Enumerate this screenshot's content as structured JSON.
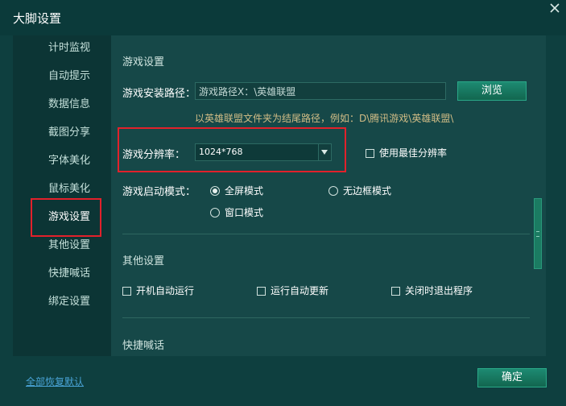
{
  "window": {
    "title": "大脚设置"
  },
  "sidebar": {
    "items": [
      {
        "label": "计时监视"
      },
      {
        "label": "自动提示"
      },
      {
        "label": "数据信息"
      },
      {
        "label": "截图分享"
      },
      {
        "label": "字体美化"
      },
      {
        "label": "鼠标美化"
      },
      {
        "label": "游戏设置"
      },
      {
        "label": "其他设置"
      },
      {
        "label": "快捷喊话"
      },
      {
        "label": "绑定设置"
      }
    ],
    "selected": "游戏设置"
  },
  "game_settings": {
    "title": "游戏设置",
    "install_path_label": "游戏安装路径：",
    "install_path_value": "游戏路径X：\\英雄联盟",
    "browse_label": "浏览",
    "hint": "以英雄联盟文件夹为结尾路径，例如：D\\腾讯游戏\\英雄联盟\\",
    "resolution_label": "游戏分辨率：",
    "resolution_value": "1024*768",
    "best_resolution_label": "使用最佳分辨率",
    "best_resolution_checked": false,
    "launch_mode_label": "游戏启动模式：",
    "launch_modes": [
      {
        "label": "全屏模式",
        "selected": true
      },
      {
        "label": "无边框模式",
        "selected": false
      },
      {
        "label": "窗口模式",
        "selected": false
      }
    ]
  },
  "other_settings": {
    "title": "其他设置",
    "options": [
      {
        "label": "开机自动运行",
        "checked": false
      },
      {
        "label": "运行自动更新",
        "checked": false
      },
      {
        "label": "关闭时退出程序",
        "checked": false
      }
    ]
  },
  "quick_chat": {
    "title": "快捷喊话"
  },
  "footer": {
    "reset_label": "全部恢复默认",
    "ok_label": "确定"
  },
  "colors": {
    "background": "#0e3f3f",
    "panel": "#164848",
    "sidebar": "#0c3535",
    "accent_button": "#1d8a72",
    "highlight_border": "#e2212b",
    "hint_text": "#d2bd86",
    "link": "#49a3d6"
  }
}
